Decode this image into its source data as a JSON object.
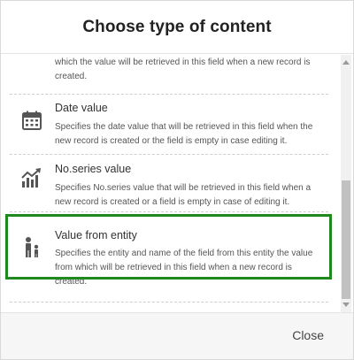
{
  "dialog": {
    "title": "Choose type of content",
    "close_label": "Close"
  },
  "items": [
    {
      "name": "",
      "desc_lines": [
        "which the value will be retrieved in this field when a new record is",
        "created."
      ],
      "icon": "none"
    },
    {
      "name": "Date value",
      "desc_lines": [
        "Specifies the date value that will be retrieved in this field when the",
        "new record is created or the field is empty in case editing it."
      ],
      "icon": "calendar-icon"
    },
    {
      "name": "No.series value",
      "desc_lines": [
        "Specifies No.series value that will be retrieved in this field when a",
        "new record is created or a field is empty in case of editing it."
      ],
      "icon": "chart-growth-icon",
      "highlighted": true
    },
    {
      "name": "Value from entity",
      "desc_lines": [
        "Specifies the entity and name of the field from this entity the value",
        "from which will be retrieved in this field when a new record is",
        "created."
      ],
      "icon": "family-icon"
    }
  ],
  "colors": {
    "highlight": "#1e8a1e",
    "icon": "#555555"
  }
}
